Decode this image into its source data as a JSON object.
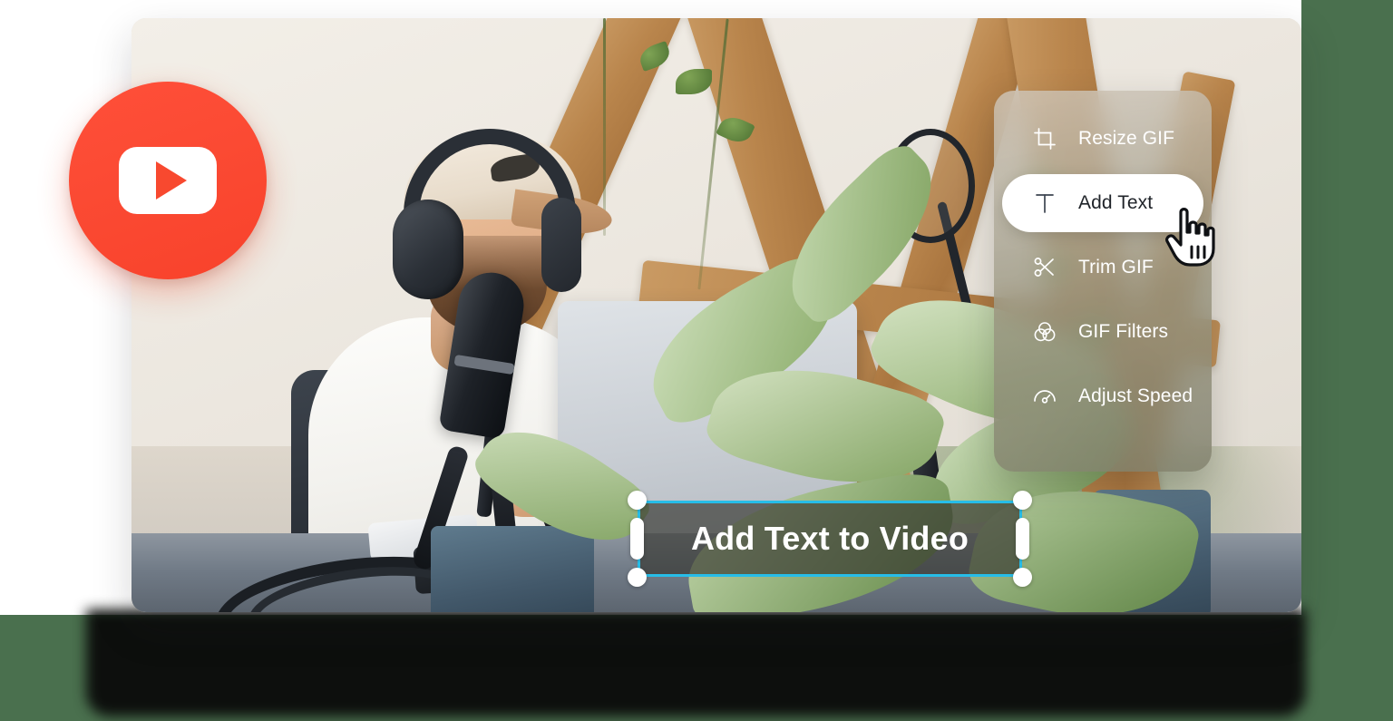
{
  "brand": {
    "badge_icon": "youtube-play-icon",
    "badge_color": "#f8492f"
  },
  "menu": {
    "items": [
      {
        "label": "Resize GIF",
        "icon": "crop-icon",
        "active": false
      },
      {
        "label": "Add Text",
        "icon": "text-tool-icon",
        "active": true
      },
      {
        "label": "Trim GIF",
        "icon": "scissors-icon",
        "active": false
      },
      {
        "label": "GIF Filters",
        "icon": "venn-filter-icon",
        "active": false
      },
      {
        "label": "Adjust Speed",
        "icon": "speedometer-icon",
        "active": false
      }
    ],
    "active_index": 1,
    "panel_color": "#9a9782",
    "active_item_color": "#ffffff"
  },
  "cursor": {
    "icon": "pointing-hand-cursor"
  },
  "canvas": {
    "text_overlay": {
      "value": "Add Text to Video",
      "selection_color": "#27bde8",
      "text_color": "#ffffff",
      "box_fill": "rgba(52,52,46,0.66)",
      "handles": [
        "top-left",
        "top-right",
        "bottom-left",
        "bottom-right",
        "middle-left",
        "middle-right"
      ]
    }
  },
  "theme": {
    "page_background": "#4a704e",
    "card_background": "#ffffff",
    "shadow_color": "#0d0f0d"
  }
}
